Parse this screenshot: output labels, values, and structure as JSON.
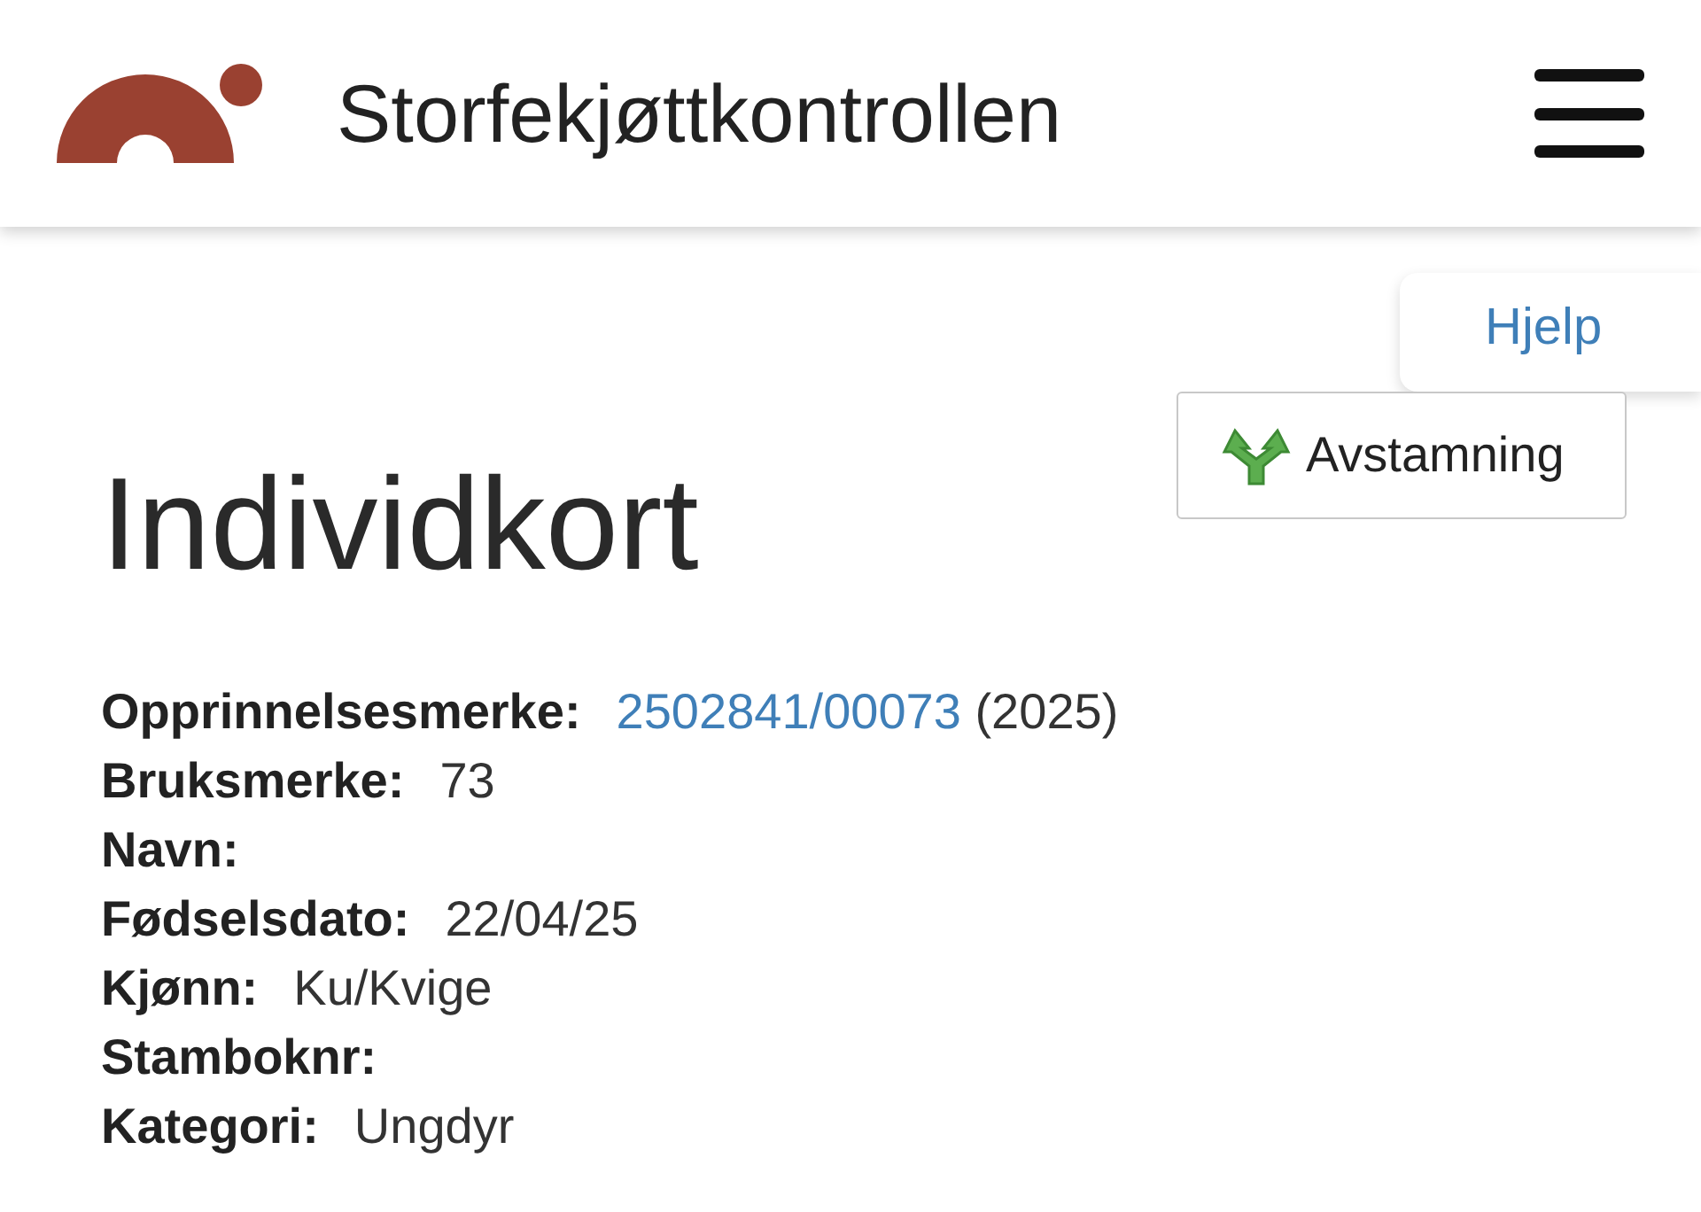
{
  "header": {
    "title": "Storfekjøttkontrollen"
  },
  "help_tab": {
    "label": "Hjelp"
  },
  "pedigree_button": {
    "label": "Avstamning"
  },
  "page_title": "Individkort",
  "fields": [
    {
      "kind": "link",
      "label": "Opprinnelsesmerke:",
      "value": "2502841/00073",
      "suffix": "(2025)"
    },
    {
      "kind": "text",
      "label": "Bruksmerke:",
      "value": "73"
    },
    {
      "kind": "text",
      "label": "Navn:"
    },
    {
      "kind": "text",
      "label": "Fødselsdato:",
      "value": "22/04/25"
    },
    {
      "kind": "text",
      "label": "Kjønn:",
      "value": "Ku/Kvige"
    },
    {
      "kind": "text",
      "label": "Stamboknr:"
    },
    {
      "kind": "text",
      "label": "Kategori:",
      "value": "Ungdyr"
    }
  ]
}
